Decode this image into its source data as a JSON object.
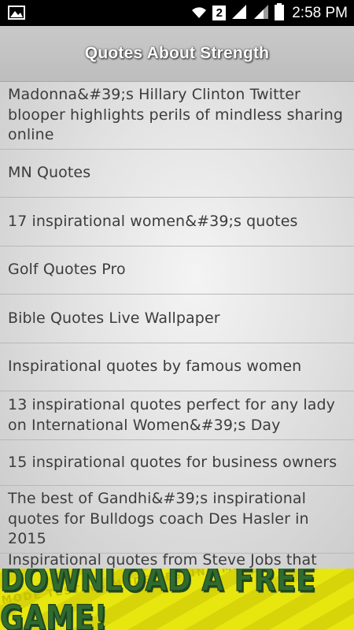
{
  "status_bar": {
    "time": "2:58 PM",
    "sim_badge": "2",
    "icons": [
      "image-icon",
      "wifi-icon",
      "signal-icon",
      "signal-icon",
      "battery-icon"
    ]
  },
  "header": {
    "title": "Quotes About Strength"
  },
  "list": {
    "items": [
      {
        "label": "Madonna&#39;s Hillary Clinton Twitter blooper highlights perils of mindless sharing online"
      },
      {
        "label": "MN Quotes"
      },
      {
        "label": "17 inspirational women&#39;s quotes"
      },
      {
        "label": "Golf Quotes Pro"
      },
      {
        "label": "Bible Quotes Live Wallpaper"
      },
      {
        "label": "Inspirational quotes by famous women"
      },
      {
        "label": "13 inspirational quotes perfect for any lady on International Women&#39;s Day"
      },
      {
        "label": "15 inspirational quotes for business owners"
      },
      {
        "label": "The best of Gandhi&#39;s inspirational quotes for Bulldogs coach Des Hasler in 2015"
      },
      {
        "label": "Inspirational quotes from Steve Jobs that"
      }
    ]
  },
  "ad": {
    "text": "DOWNLOAD A FREE GAME!",
    "watermark": "MODE TESTING MODE TESTING MODE TESTING MODE TESTING"
  }
}
